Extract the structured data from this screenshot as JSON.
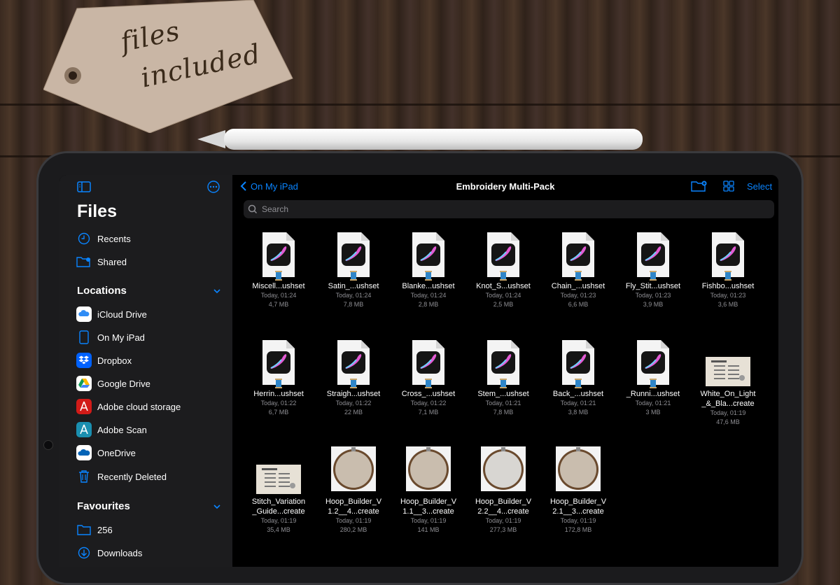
{
  "tag": {
    "line1": "files",
    "line2": "included"
  },
  "sidebar": {
    "title": "Files",
    "top_items": [
      {
        "label": "Recents",
        "icon": "clock-icon"
      },
      {
        "label": "Shared",
        "icon": "shared-folder-icon"
      }
    ],
    "locations_title": "Locations",
    "locations": [
      {
        "label": "iCloud Drive",
        "icon": "icloud-icon"
      },
      {
        "label": "On My iPad",
        "icon": "ipad-icon"
      },
      {
        "label": "Dropbox",
        "icon": "dropbox-icon"
      },
      {
        "label": "Google Drive",
        "icon": "google-drive-icon"
      },
      {
        "label": "Adobe cloud storage",
        "icon": "adobe-acrobat-icon"
      },
      {
        "label": "Adobe Scan",
        "icon": "adobe-scan-icon"
      },
      {
        "label": "OneDrive",
        "icon": "onedrive-icon"
      },
      {
        "label": "Recently Deleted",
        "icon": "trash-icon"
      }
    ],
    "favourites_title": "Favourites",
    "favourites": [
      {
        "label": "256",
        "icon": "folder-icon"
      },
      {
        "label": "Downloads",
        "icon": "download-icon"
      }
    ]
  },
  "main": {
    "back_label": "On My iPad",
    "title": "Embroidery Multi-Pack",
    "select_label": "Select",
    "search_placeholder": "Search",
    "files": [
      {
        "name1": "Miscell...ushset",
        "name2": "",
        "date": "Today, 01:24",
        "size": "4,7 MB",
        "kind": "brushset"
      },
      {
        "name1": "Satin_...ushset",
        "name2": "",
        "date": "Today, 01:24",
        "size": "7,8 MB",
        "kind": "brushset"
      },
      {
        "name1": "Blanke...ushset",
        "name2": "",
        "date": "Today, 01:24",
        "size": "2,8 MB",
        "kind": "brushset"
      },
      {
        "name1": "Knot_S...ushset",
        "name2": "",
        "date": "Today, 01:24",
        "size": "2,5 MB",
        "kind": "brushset"
      },
      {
        "name1": "Chain_...ushset",
        "name2": "",
        "date": "Today, 01:23",
        "size": "6,6 MB",
        "kind": "brushset"
      },
      {
        "name1": "Fly_Stit...ushset",
        "name2": "",
        "date": "Today, 01:23",
        "size": "3,9 MB",
        "kind": "brushset"
      },
      {
        "name1": "Fishbo...ushset",
        "name2": "",
        "date": "Today, 01:23",
        "size": "3,6 MB",
        "kind": "brushset"
      },
      {
        "name1": "Herrin...ushset",
        "name2": "",
        "date": "Today, 01:22",
        "size": "6,7 MB",
        "kind": "brushset"
      },
      {
        "name1": "Straigh...ushset",
        "name2": "",
        "date": "Today, 01:22",
        "size": "22 MB",
        "kind": "brushset"
      },
      {
        "name1": "Cross_...ushset",
        "name2": "",
        "date": "Today, 01:22",
        "size": "7,1 MB",
        "kind": "brushset"
      },
      {
        "name1": "Stem_...ushset",
        "name2": "",
        "date": "Today, 01:21",
        "size": "7,8 MB",
        "kind": "brushset"
      },
      {
        "name1": "Back_...ushset",
        "name2": "",
        "date": "Today, 01:21",
        "size": "3,8 MB",
        "kind": "brushset"
      },
      {
        "name1": "_Runni...ushset",
        "name2": "",
        "date": "Today, 01:21",
        "size": "3 MB",
        "kind": "brushset"
      },
      {
        "name1": "White_On_Light",
        "name2": "_&_Bla...create",
        "date": "Today, 01:19",
        "size": "47,6 MB",
        "kind": "document"
      },
      {
        "name1": "Stitch_Variation",
        "name2": "_Guide...create",
        "date": "Today, 01:19",
        "size": "35,4 MB",
        "kind": "document"
      },
      {
        "name1": "Hoop_Builder_V",
        "name2": "1.2__4...create",
        "date": "Today, 01:19",
        "size": "280,2 MB",
        "kind": "hoop"
      },
      {
        "name1": "Hoop_Builder_V",
        "name2": "1.1__3...create",
        "date": "Today, 01:19",
        "size": "141 MB",
        "kind": "hoop"
      },
      {
        "name1": "Hoop_Builder_V",
        "name2": "2.2__4...create",
        "date": "Today, 01:19",
        "size": "277,3 MB",
        "kind": "hoop-light"
      },
      {
        "name1": "Hoop_Builder_V",
        "name2": "2.1__3...create",
        "date": "Today, 01:19",
        "size": "172,8 MB",
        "kind": "hoop"
      }
    ]
  },
  "colors": {
    "accent": "#0a84ff",
    "sidebar_bg": "#1c1c1e",
    "main_bg": "#000000"
  }
}
